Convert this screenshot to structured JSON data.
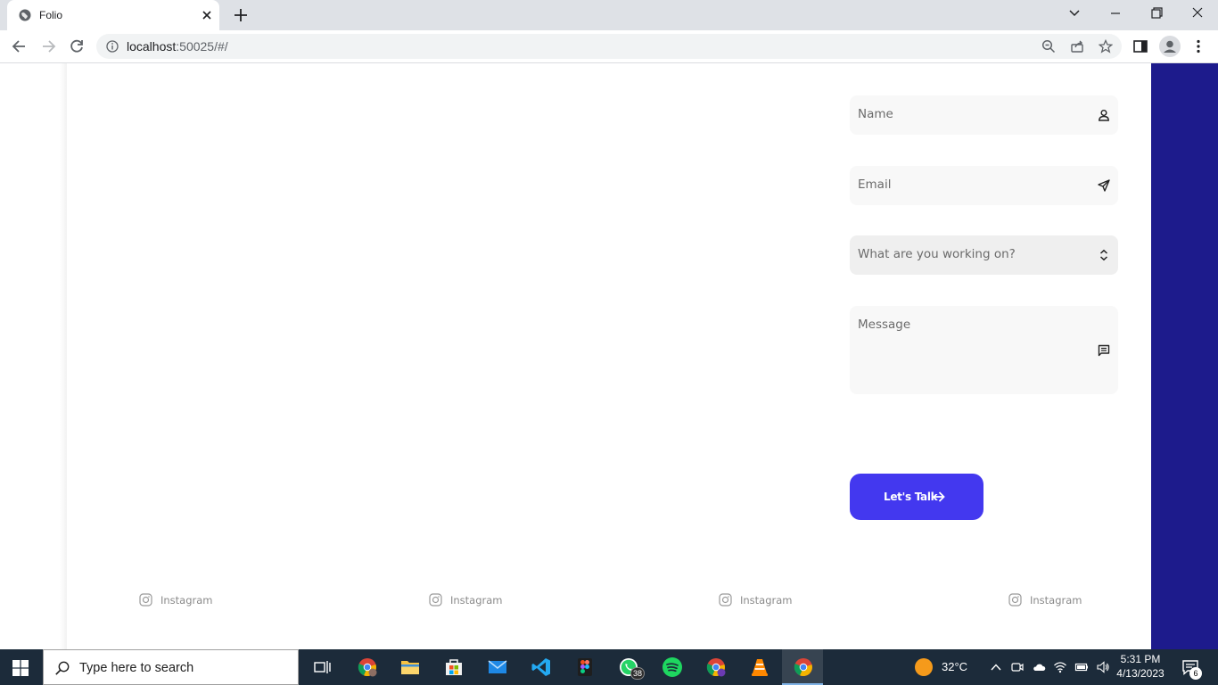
{
  "browser": {
    "tab_title": "Folio",
    "url_host": "localhost",
    "url_rest": ":50025/#/"
  },
  "form": {
    "name_placeholder": "Name",
    "email_placeholder": "Email",
    "project_select_value": "What are you working on?",
    "message_placeholder": "Message",
    "submit_label": "Let's Talk"
  },
  "socials": [
    {
      "label": "Instagram",
      "icon": "instagram-icon"
    },
    {
      "label": "Instagram",
      "icon": "instagram-icon"
    },
    {
      "label": "Instagram",
      "icon": "instagram-icon"
    },
    {
      "label": "Instagram",
      "icon": "instagram-icon"
    }
  ],
  "taskbar": {
    "search_placeholder": "Type here to search",
    "whatsapp_badge": "38",
    "weather_temp": "32°C",
    "time": "5:31 PM",
    "date": "4/13/2023",
    "notification_count": "6"
  },
  "colors": {
    "accent": "#4338ef",
    "side_panel": "#1d1b8c",
    "field_bg": "#f8f8f8"
  }
}
